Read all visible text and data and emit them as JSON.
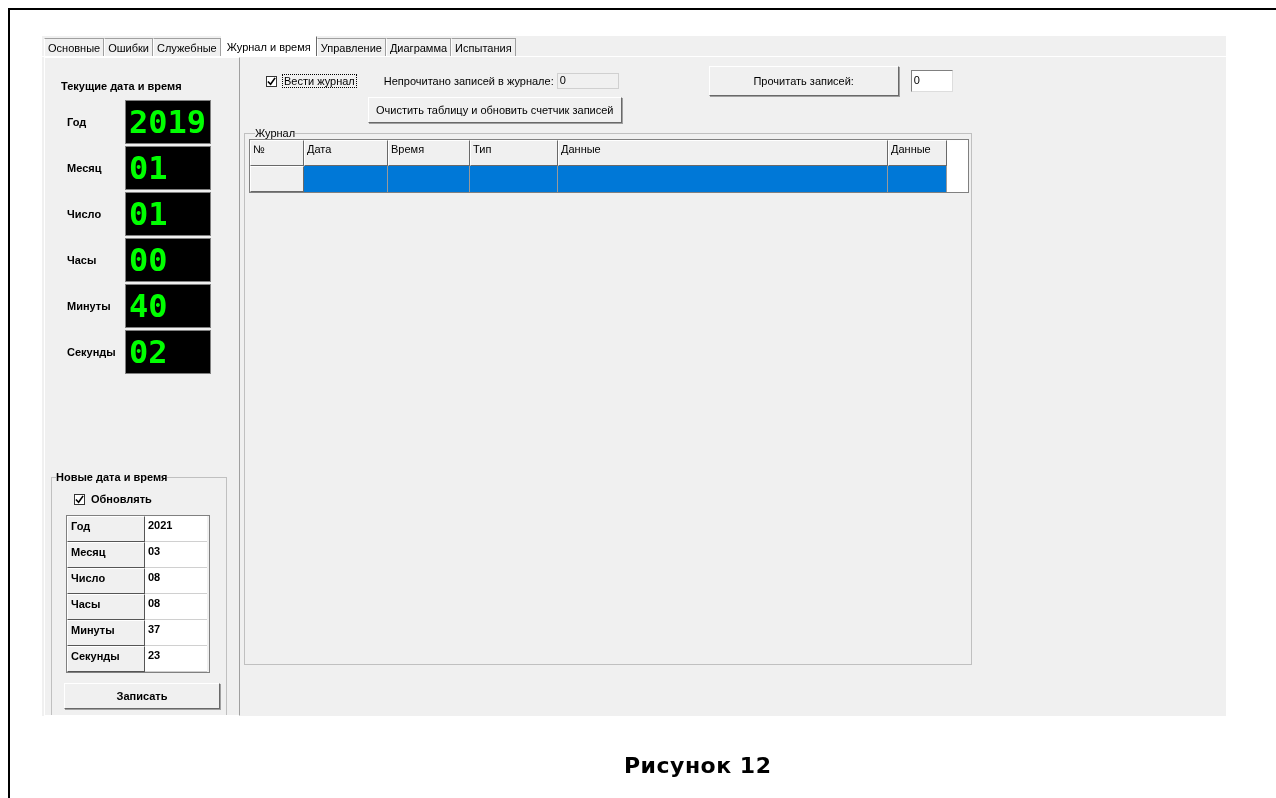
{
  "tabs": [
    {
      "label": "Основные",
      "selected": false
    },
    {
      "label": "Ошибки",
      "selected": false
    },
    {
      "label": "Служебные",
      "selected": false
    },
    {
      "label": "Журнал и время",
      "selected": true
    },
    {
      "label": "Управление",
      "selected": false
    },
    {
      "label": "Диаграмма",
      "selected": false
    },
    {
      "label": "Испытания",
      "selected": false
    }
  ],
  "current": {
    "title": "Текущие дата и время",
    "rows": [
      {
        "label": "Год",
        "value": "2019"
      },
      {
        "label": "Месяц",
        "value": "01"
      },
      {
        "label": "Число",
        "value": "01"
      },
      {
        "label": "Часы",
        "value": "00"
      },
      {
        "label": "Минуты",
        "value": "40"
      },
      {
        "label": "Секунды",
        "value": "02"
      }
    ]
  },
  "new": {
    "title": "Новые дата и время",
    "update": {
      "label": "Обновлять",
      "checked": true
    },
    "rows": [
      {
        "label": "Год",
        "value": "2021"
      },
      {
        "label": "Месяц",
        "value": "03"
      },
      {
        "label": "Число",
        "value": "08"
      },
      {
        "label": "Часы",
        "value": "08"
      },
      {
        "label": "Минуты",
        "value": "37"
      },
      {
        "label": "Секунды",
        "value": "23"
      }
    ],
    "button": "Записать"
  },
  "log": {
    "keep": {
      "label": "Вести журнал",
      "checked": true
    },
    "unread_label": "Непрочитано записей в журнале:",
    "unread_value": "0",
    "clear_button": "Очистить таблицу и обновить счетчик записей",
    "read_button": "Прочитать записей:",
    "read_count": "0"
  },
  "journal": {
    "title": "Журнал",
    "columns": [
      "№",
      "Дата",
      "Время",
      "Тип",
      "Данные",
      "Данные"
    ],
    "rows": [
      {
        "selected": true
      }
    ]
  },
  "caption": "Рисунок 12"
}
